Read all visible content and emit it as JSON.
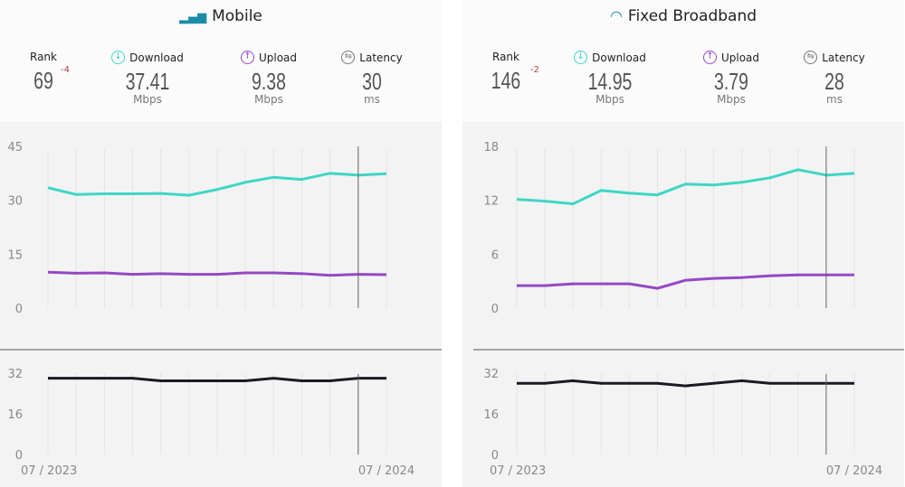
{
  "colors": {
    "download": "#3fd6c6",
    "upload": "#9647c6",
    "latency": "#1a1a24",
    "title_icon": "#1b8ca8"
  },
  "panels": [
    {
      "title": "Mobile",
      "icon": "signal-bars-icon",
      "rank_label": "Rank",
      "rank": "69",
      "rank_change": "-4",
      "download_label": "Download",
      "download": "37.41",
      "download_unit": "Mbps",
      "upload_label": "Upload",
      "upload": "9.38",
      "upload_unit": "Mbps",
      "latency_label": "Latency",
      "latency": "30",
      "latency_unit": "ms"
    },
    {
      "title": "Fixed Broadband",
      "icon": "wifi-icon",
      "rank_label": "Rank",
      "rank": "146",
      "rank_change": "-2",
      "download_label": "Download",
      "download": "14.95",
      "download_unit": "Mbps",
      "upload_label": "Upload",
      "upload": "3.79",
      "upload_unit": "Mbps",
      "latency_label": "Latency",
      "latency": "28",
      "latency_unit": "ms"
    }
  ],
  "chart_data": [
    {
      "type": "line",
      "panel": "Mobile",
      "x_tick_labels": [
        "07 / 2023",
        "07 / 2024"
      ],
      "points": 13,
      "cursor_index": 11,
      "speed": {
        "yticks": [
          0,
          15,
          30,
          45
        ],
        "ylim": [
          0,
          45
        ],
        "series": [
          {
            "key": "download",
            "values": [
              33.5,
              31.6,
              31.8,
              31.8,
              31.9,
              31.4,
              33,
              35,
              36.4,
              35.8,
              37.5,
              37,
              37.4
            ]
          },
          {
            "key": "upload",
            "values": [
              10,
              9.7,
              9.8,
              9.4,
              9.6,
              9.4,
              9.4,
              9.8,
              9.8,
              9.6,
              9.1,
              9.4,
              9.3
            ]
          }
        ]
      },
      "latency": {
        "yticks": [
          0,
          16,
          32
        ],
        "ylim": [
          0,
          32
        ],
        "values": [
          30,
          30,
          30,
          30,
          29,
          29,
          29,
          29,
          30,
          29,
          29,
          30,
          30
        ]
      }
    },
    {
      "type": "line",
      "panel": "Fixed Broadband",
      "x_tick_labels": [
        "07 / 2023",
        "07 / 2024"
      ],
      "points": 13,
      "cursor_index": 11,
      "speed": {
        "yticks": [
          0,
          6,
          12,
          18
        ],
        "ylim": [
          0,
          18
        ],
        "series": [
          {
            "key": "download",
            "values": [
              12.1,
              11.9,
              11.6,
              13.1,
              12.8,
              12.6,
              13.8,
              13.7,
              14.0,
              14.5,
              15.4,
              14.8,
              15.0
            ]
          },
          {
            "key": "upload",
            "values": [
              2.5,
              2.5,
              2.7,
              2.7,
              2.7,
              2.2,
              3.1,
              3.3,
              3.4,
              3.6,
              3.7,
              3.7,
              3.7
            ]
          }
        ]
      },
      "latency": {
        "yticks": [
          0,
          16,
          32
        ],
        "ylim": [
          0,
          32
        ],
        "values": [
          28,
          28,
          29,
          28,
          28,
          28,
          27,
          28,
          29,
          28,
          28,
          28,
          28
        ]
      }
    }
  ]
}
